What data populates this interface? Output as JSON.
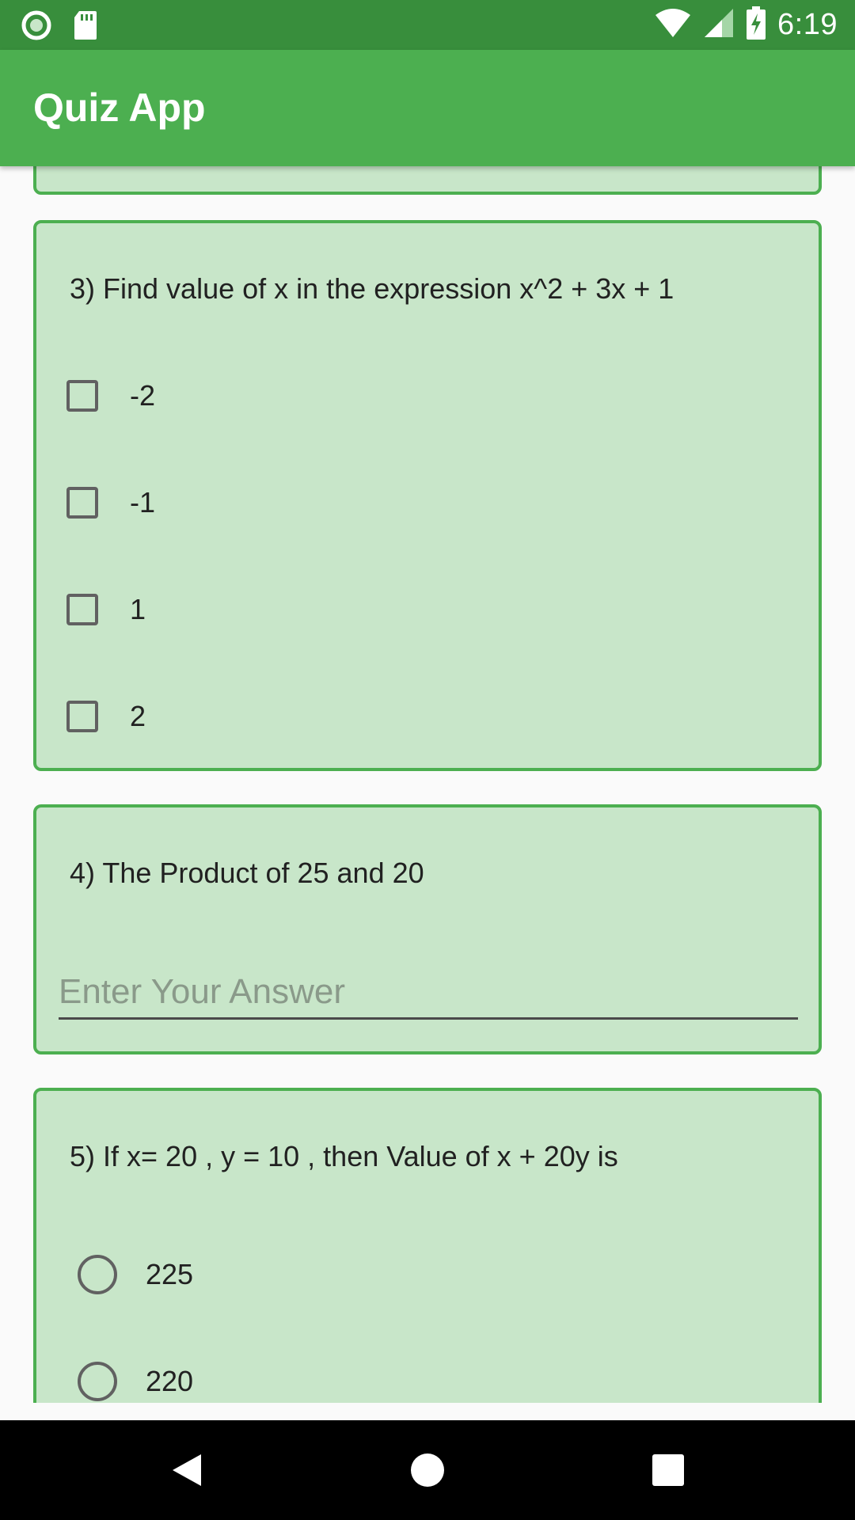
{
  "status_bar": {
    "time": "6:19",
    "icons": [
      "notification-circle-icon",
      "sd-card-icon",
      "wifi-icon",
      "signal-icon",
      "battery-charging-icon"
    ]
  },
  "app_bar": {
    "title": "Quiz App"
  },
  "questions": {
    "q3": {
      "text": "3) Find value of x in the expression x^2 + 3x + 1",
      "type": "checkbox",
      "options": [
        "-2",
        "-1",
        "1",
        "2"
      ]
    },
    "q4": {
      "text": "4) The Product of 25 and 20",
      "type": "text",
      "placeholder": "Enter Your Answer",
      "value": ""
    },
    "q5": {
      "text": "5) If x= 20 , y = 10 , then Value of x + 20y is",
      "type": "radio",
      "options": [
        "225",
        "220"
      ]
    }
  },
  "nav_bar": {
    "icons": [
      "back-icon",
      "home-icon",
      "recents-icon"
    ]
  },
  "colors": {
    "status_bar": "#388e3c",
    "app_bar": "#4caf50",
    "card_background": "#c8e6c9",
    "card_border": "#4caf50"
  }
}
